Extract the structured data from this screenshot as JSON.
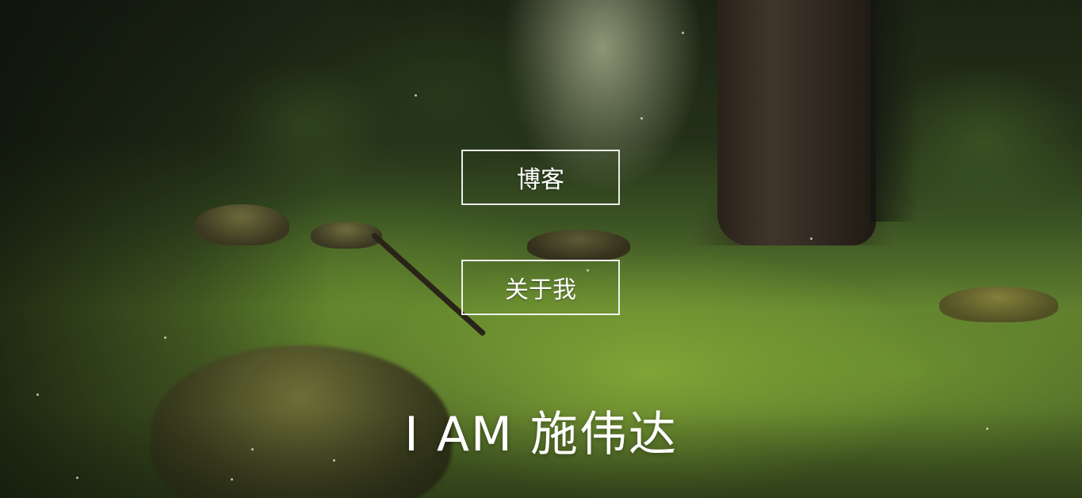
{
  "menu": {
    "blog_label": "博客",
    "about_label": "关于我"
  },
  "hero": {
    "title": "I AM 施伟达"
  },
  "colors": {
    "text": "#ffffff",
    "button_border": "#ffffff"
  }
}
